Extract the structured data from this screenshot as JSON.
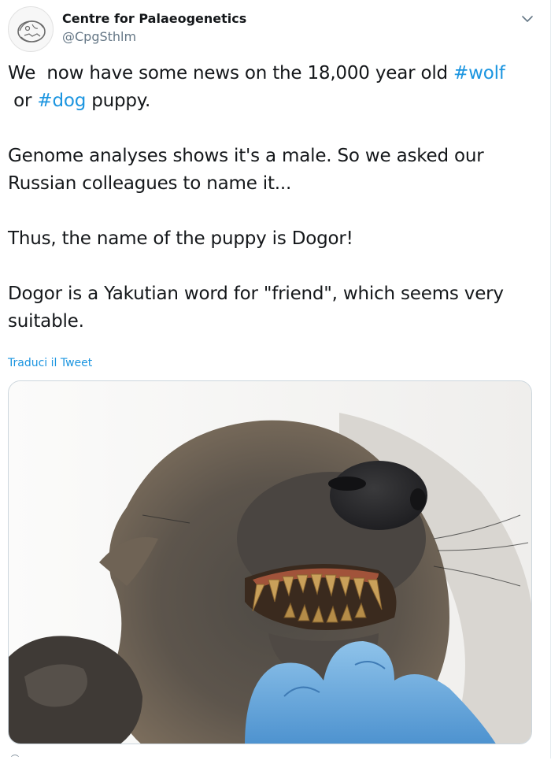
{
  "account": {
    "display_name": "Centre for Palaeogenetics",
    "handle": "@CpgSthlm",
    "avatar_icon": "skull-logo-icon"
  },
  "tweet": {
    "line1_pre": "We  now have some news on the 18,000 year old ",
    "hashtag_wolf": "#wolf",
    "line2_pre": " or ",
    "hashtag_dog": "#dog",
    "line2_post": " puppy.",
    "para2": "Genome analyses shows it's a male. So we asked our Russian colleagues to name it...",
    "para3": "Thus, the name of the puppy is Dogor!",
    "para4": "Dogor is a Yakutian word for \"friend\", which seems very suitable."
  },
  "translate_link": "Traduci il Tweet",
  "menu_icon": "chevron-down-icon",
  "media": {
    "icon": "puppy-photo"
  },
  "colors": {
    "link": "#1b95e0",
    "text": "#14171a",
    "secondary": "#657786",
    "border": "#ccd6dd"
  }
}
